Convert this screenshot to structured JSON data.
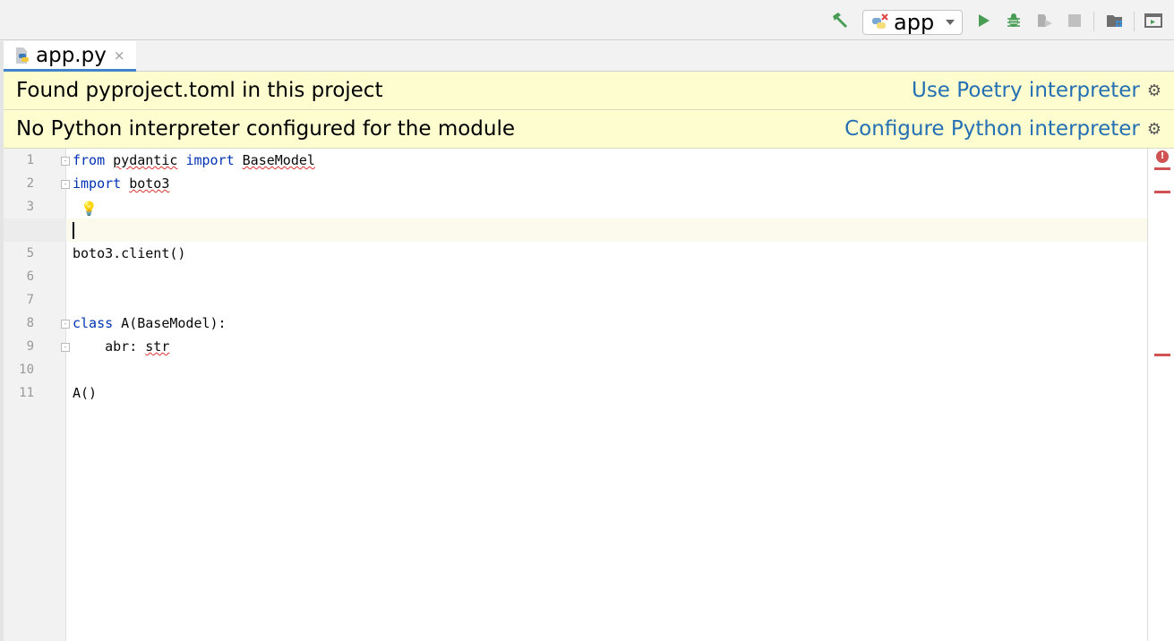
{
  "toolbar": {
    "run_config": "app",
    "colors": {
      "run": "#499c54",
      "disabled": "#b0b0b0"
    }
  },
  "tab": {
    "filename": "app.py",
    "close": "×"
  },
  "banners": [
    {
      "message": "Found pyproject.toml in this project",
      "action": "Use Poetry interpreter"
    },
    {
      "message": "No Python interpreter configured for the module",
      "action": "Configure Python interpreter"
    }
  ],
  "editor": {
    "current_line": 4,
    "lines": [
      {
        "n": "1",
        "tokens": [
          {
            "t": "from",
            "c": "kw"
          },
          {
            "t": " "
          },
          {
            "t": "pydantic",
            "c": "err"
          },
          {
            "t": " "
          },
          {
            "t": "import",
            "c": "kw"
          },
          {
            "t": " "
          },
          {
            "t": "BaseModel",
            "c": "err"
          }
        ]
      },
      {
        "n": "2",
        "tokens": [
          {
            "t": "import",
            "c": "kw"
          },
          {
            "t": " "
          },
          {
            "t": "boto3",
            "c": "err"
          }
        ]
      },
      {
        "n": "3",
        "tokens": []
      },
      {
        "n": "4",
        "tokens": []
      },
      {
        "n": "5",
        "tokens": [
          {
            "t": "boto3.client()"
          }
        ]
      },
      {
        "n": "6",
        "tokens": []
      },
      {
        "n": "7",
        "tokens": []
      },
      {
        "n": "8",
        "tokens": [
          {
            "t": "class",
            "c": "kw"
          },
          {
            "t": " A(BaseModel):"
          }
        ]
      },
      {
        "n": "9",
        "tokens": [
          {
            "t": "    abr: "
          },
          {
            "t": "str",
            "c": "err"
          }
        ]
      },
      {
        "n": "10",
        "tokens": []
      },
      {
        "n": "11",
        "tokens": [
          {
            "t": "A()"
          }
        ]
      }
    ],
    "error_indicator": "!"
  }
}
